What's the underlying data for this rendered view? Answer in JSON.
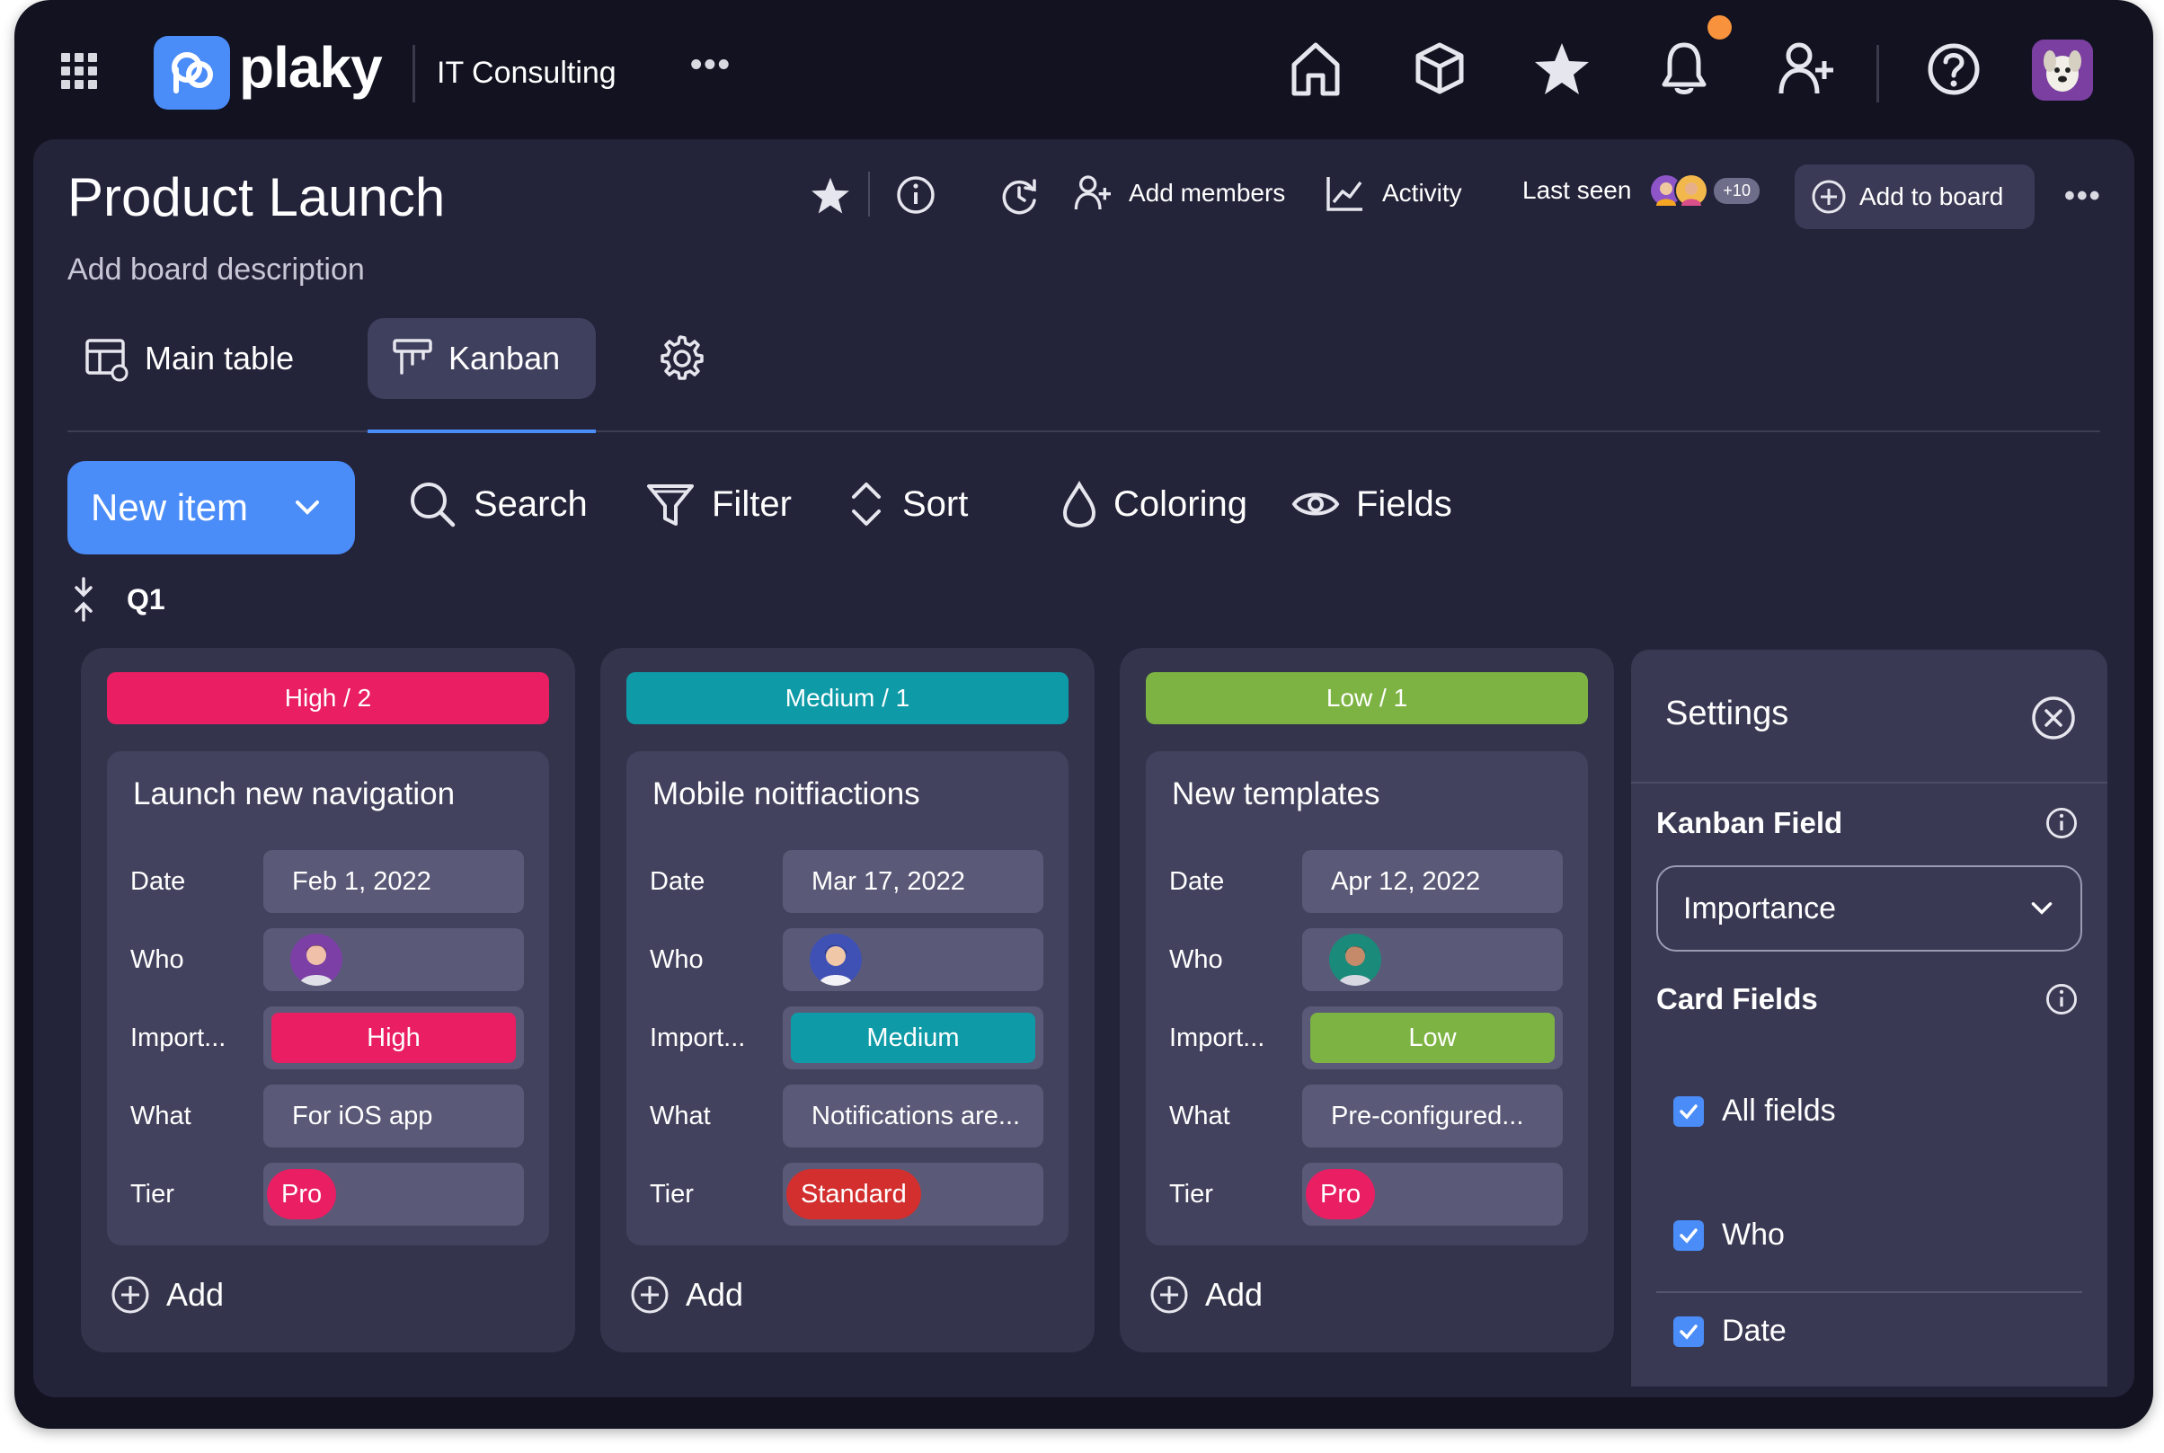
{
  "app": {
    "brand": "plaky",
    "workspace": "IT Consulting"
  },
  "topnav": {
    "icons": [
      "home-icon",
      "cube-icon",
      "star-icon",
      "bell-icon",
      "add-user-icon",
      "help-icon"
    ]
  },
  "board": {
    "title": "Product Launch",
    "description": "Add board description",
    "actions": {
      "add_members": "Add members",
      "activity": "Activity",
      "last_seen": "Last seen",
      "last_seen_more": "+10",
      "add_to_board": "Add to board"
    },
    "tabs": [
      {
        "label": "Main table"
      },
      {
        "label": "Kanban"
      }
    ],
    "toolbar": {
      "new_item": "New item",
      "search": "Search",
      "filter": "Filter",
      "sort": "Sort",
      "coloring": "Coloring",
      "fields": "Fields"
    },
    "group": "Q1"
  },
  "field_labels": {
    "date": "Date",
    "who": "Who",
    "importance": "Import...",
    "what": "What",
    "tier": "Tier"
  },
  "add_label": "Add",
  "columns": [
    {
      "header": "High / 2",
      "color": "#e91e63",
      "card": {
        "title": "Launch new navigation",
        "date": "Feb 1, 2022",
        "importance": "High",
        "importance_color": "#e91e63",
        "what": "For iOS app",
        "tier": "Pro",
        "tier_color": "#e91e63"
      }
    },
    {
      "header": "Medium / 1",
      "color": "#0e9aa7",
      "card": {
        "title": "Mobile noitfiactions",
        "date": "Mar 17, 2022",
        "importance": "Medium",
        "importance_color": "#0e9aa7",
        "what": "Notifications are...",
        "tier": "Standard",
        "tier_color": "#d32f2f"
      }
    },
    {
      "header": "Low / 1",
      "color": "#7cb342",
      "card": {
        "title": "New templates",
        "date": "Apr 12, 2022",
        "importance": "Low",
        "importance_color": "#7cb342",
        "what": "Pre-configured...",
        "tier": "Pro",
        "tier_color": "#e91e63"
      }
    }
  ],
  "settings": {
    "title": "Settings",
    "kanban_field_label": "Kanban Field",
    "kanban_field_value": "Importance",
    "card_fields_label": "Card Fields",
    "fields": [
      {
        "label": "All fields",
        "checked": true
      },
      {
        "label": "Who",
        "checked": true
      },
      {
        "label": "Date",
        "checked": true
      }
    ]
  },
  "colors": {
    "accent": "#4a8cf8",
    "notification": "#f8923c"
  }
}
